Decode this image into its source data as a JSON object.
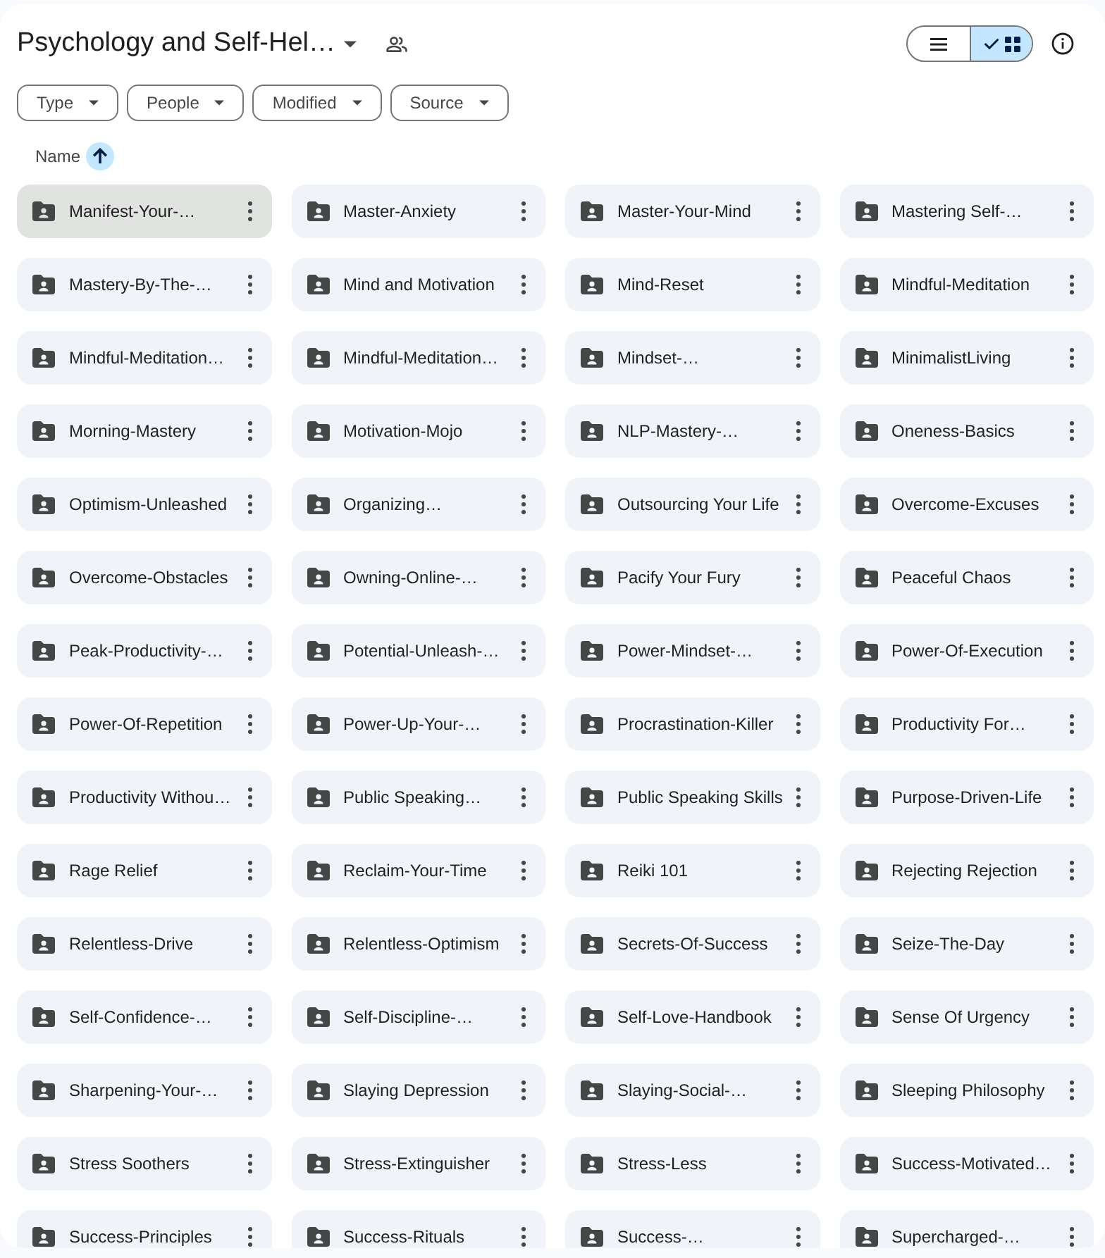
{
  "header": {
    "title": "Psychology and Self-Hel…",
    "shared": true,
    "view_toggle": [
      {
        "kind": "list",
        "selected": false
      },
      {
        "kind": "grid",
        "selected": true
      }
    ]
  },
  "filters": [
    {
      "label": "Type"
    },
    {
      "label": "People"
    },
    {
      "label": "Modified"
    },
    {
      "label": "Source"
    }
  ],
  "sort": {
    "label": "Name",
    "ascending": true
  },
  "folders": [
    {
      "name": "Manifest-Your-…",
      "selected": true
    },
    {
      "name": "Master-Anxiety",
      "selected": false
    },
    {
      "name": "Master-Your-Mind",
      "selected": false
    },
    {
      "name": "Mastering Self-…",
      "selected": false
    },
    {
      "name": "Mastery-By-The-…",
      "selected": false
    },
    {
      "name": "Mind and Motivation",
      "selected": false
    },
    {
      "name": "Mind-Reset",
      "selected": false
    },
    {
      "name": "Mindful-Meditation",
      "selected": false
    },
    {
      "name": "Mindful-Meditation…",
      "selected": false
    },
    {
      "name": "Mindful-Meditation…",
      "selected": false
    },
    {
      "name": "Mindset-…",
      "selected": false
    },
    {
      "name": "MinimalistLiving",
      "selected": false
    },
    {
      "name": "Morning-Mastery",
      "selected": false
    },
    {
      "name": "Motivation-Mojo",
      "selected": false
    },
    {
      "name": "NLP-Mastery-…",
      "selected": false
    },
    {
      "name": "Oneness-Basics",
      "selected": false
    },
    {
      "name": "Optimism-Unleashed",
      "selected": false
    },
    {
      "name": "Organizing…",
      "selected": false
    },
    {
      "name": "Outsourcing Your Life",
      "selected": false
    },
    {
      "name": "Overcome-Excuses",
      "selected": false
    },
    {
      "name": "Overcome-Obstacles",
      "selected": false
    },
    {
      "name": "Owning-Online-…",
      "selected": false
    },
    {
      "name": "Pacify Your Fury",
      "selected": false
    },
    {
      "name": "Peaceful Chaos",
      "selected": false
    },
    {
      "name": "Peak-Productivity-…",
      "selected": false
    },
    {
      "name": "Potential-Unleash-…",
      "selected": false
    },
    {
      "name": "Power-Mindset-…",
      "selected": false
    },
    {
      "name": "Power-Of-Execution",
      "selected": false
    },
    {
      "name": "Power-Of-Repetition",
      "selected": false
    },
    {
      "name": "Power-Up-Your-…",
      "selected": false
    },
    {
      "name": "Procrastination-Killer",
      "selected": false
    },
    {
      "name": "Productivity For…",
      "selected": false
    },
    {
      "name": "Productivity Withou…",
      "selected": false
    },
    {
      "name": "Public Speaking…",
      "selected": false
    },
    {
      "name": "Public Speaking Skills",
      "selected": false
    },
    {
      "name": "Purpose-Driven-Life",
      "selected": false
    },
    {
      "name": "Rage Relief",
      "selected": false
    },
    {
      "name": "Reclaim-Your-Time",
      "selected": false
    },
    {
      "name": "Reiki 101",
      "selected": false
    },
    {
      "name": "Rejecting Rejection",
      "selected": false
    },
    {
      "name": "Relentless-Drive",
      "selected": false
    },
    {
      "name": "Relentless-Optimism",
      "selected": false
    },
    {
      "name": "Secrets-Of-Success",
      "selected": false
    },
    {
      "name": "Seize-The-Day",
      "selected": false
    },
    {
      "name": "Self-Confidence-…",
      "selected": false
    },
    {
      "name": "Self-Discipline-…",
      "selected": false
    },
    {
      "name": "Self-Love-Handbook",
      "selected": false
    },
    {
      "name": "Sense Of Urgency",
      "selected": false
    },
    {
      "name": "Sharpening-Your-…",
      "selected": false
    },
    {
      "name": "Slaying Depression",
      "selected": false
    },
    {
      "name": "Slaying-Social-…",
      "selected": false
    },
    {
      "name": "Sleeping Philosophy",
      "selected": false
    },
    {
      "name": "Stress Soothers",
      "selected": false
    },
    {
      "name": "Stress-Extinguisher",
      "selected": false
    },
    {
      "name": "Stress-Less",
      "selected": false
    },
    {
      "name": "Success-Motivated…",
      "selected": false
    },
    {
      "name": "Success-Principles",
      "selected": false
    },
    {
      "name": "Success-Rituals",
      "selected": false
    },
    {
      "name": "Success-…",
      "selected": false
    },
    {
      "name": "Supercharged-…",
      "selected": false
    }
  ]
}
